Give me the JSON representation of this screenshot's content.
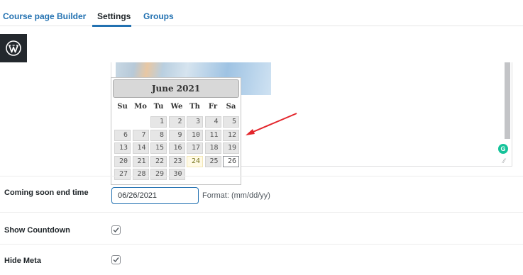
{
  "tabs": [
    {
      "label": "Course page"
    },
    {
      "label": "Builder"
    },
    {
      "label": "Settings"
    },
    {
      "label": "Groups"
    }
  ],
  "active_tab": "Settings",
  "datepicker": {
    "title": "June 2021",
    "weekdays": [
      "Su",
      "Mo",
      "Tu",
      "We",
      "Th",
      "Fr",
      "Sa"
    ],
    "weeks": [
      [
        "",
        "",
        "1",
        "2",
        "3",
        "4",
        "5"
      ],
      [
        "6",
        "7",
        "8",
        "9",
        "10",
        "11",
        "12"
      ],
      [
        "13",
        "14",
        "15",
        "16",
        "17",
        "18",
        "19"
      ],
      [
        "20",
        "21",
        "22",
        "23",
        "24",
        "25",
        "26"
      ],
      [
        "27",
        "28",
        "29",
        "30",
        "",
        "",
        ""
      ]
    ],
    "today": "24",
    "selected": "26"
  },
  "fields": {
    "end_time": {
      "label": "Coming soon end time",
      "value": "06/26/2021",
      "hint": "Format: (mm/dd/yy)"
    },
    "show_countdown": {
      "label": "Show Countdown",
      "checked": true
    },
    "hide_meta": {
      "label": "Hide Meta",
      "checked": true
    }
  },
  "colors": {
    "accent": "#2271b1",
    "arrow": "#e3262c",
    "grammarly": "#15c39a"
  },
  "icons": {
    "logo": "wordpress-icon",
    "check": "checkmark-icon",
    "grammarly": "grammarly-icon"
  }
}
